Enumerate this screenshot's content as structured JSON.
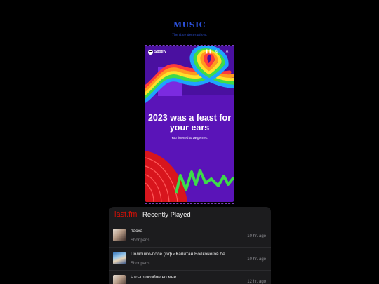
{
  "site": {
    "title": "MUSIC",
    "subtitle": "The time decorations.",
    "title_color": "#2b4fd6"
  },
  "story": {
    "app_name": "Spotify",
    "pause_icon": "pause-icon",
    "settings_icon": "gear-icon",
    "close_icon": "close-icon",
    "headline_line1": "2023 was a feast for",
    "headline_line2": "your ears",
    "sub_pre": "You listened to",
    "sub_count": "19",
    "sub_post": "genres.",
    "colors": {
      "background": "#5a14b8",
      "red": "#d8151d",
      "green": "#3ddc4a"
    }
  },
  "widget": {
    "logo": "last.fm",
    "title": "Recently Played",
    "tracks": [
      {
        "title": "пасха",
        "artist": "Shortparis",
        "ago": "10 hr. ago"
      },
      {
        "title": "Полюшко-поле (к/ф «Капитан Волконогов бе…",
        "artist": "Shortparis",
        "ago": "10 hr. ago"
      },
      {
        "title": "Что-то особое во мне",
        "artist": "",
        "ago": "12 hr. ago"
      }
    ]
  }
}
